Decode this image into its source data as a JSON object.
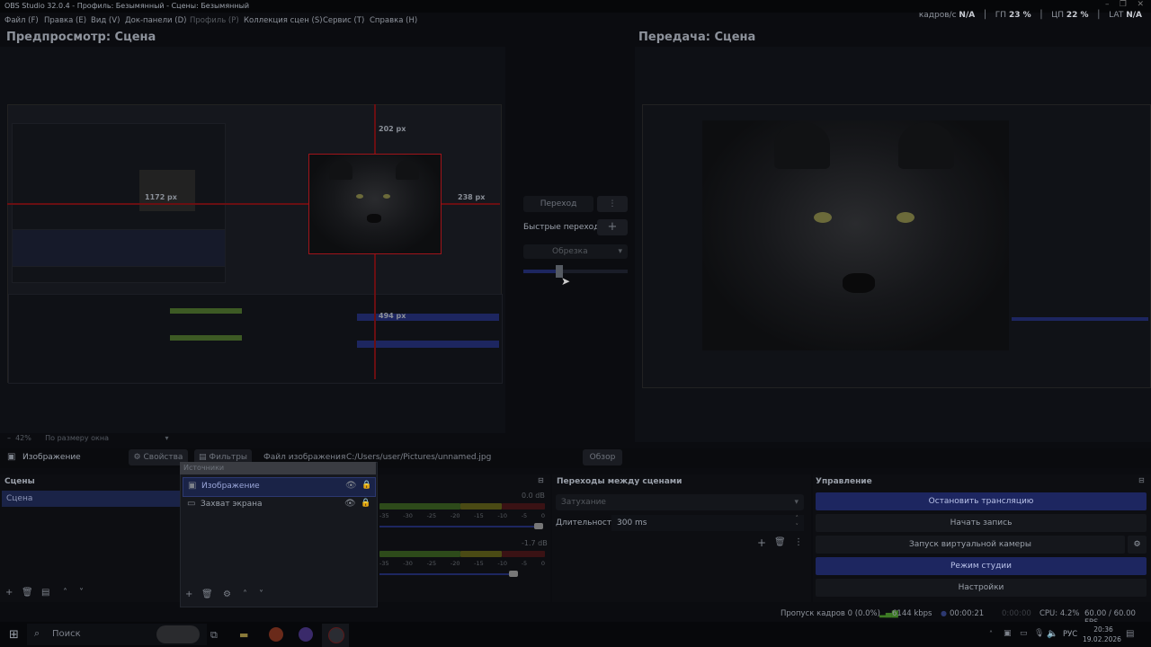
{
  "window": {
    "title": "OBS Studio 32.0.4 - Профиль: Безымянный - Сцены: Безымянный"
  },
  "menu": [
    "Файл (F)",
    "Правка (E)",
    "Вид (V)",
    "Док-панели (D)",
    "Профиль (P)",
    "Коллекция сцен (S)",
    "Сервис (T)",
    "Справка (H)"
  ],
  "stats": {
    "fps_label": "кадров/с",
    "fps": "N/A",
    "gpu_label": "ГП",
    "gpu": "23 %",
    "cpu_label": "ЦП",
    "cpu": "22 %",
    "lat_label": "LAT",
    "lat": "N/A"
  },
  "preview": {
    "title": "Предпросмотр: Сцена",
    "px_top": "202 px",
    "px_left": "1172 px",
    "px_right": "238 px",
    "px_bottom": "494 px",
    "zoom": "42%",
    "zoom_mode": "По размеру окна"
  },
  "program": {
    "title": "Передача: Сцена"
  },
  "transition_center": {
    "transition_button": "Переход",
    "quick_transitions": "Быстрые переходы",
    "dropdown": "Обрезка"
  },
  "source_toolbar": {
    "source_name": "Изображение",
    "properties": "Свойства",
    "filters": "Фильтры",
    "file_label": "Файл изображения",
    "file_path": "C:/Users/user/Pictures/unnamed.jpg",
    "browse": "Обзор"
  },
  "scenes": {
    "header": "Сцены",
    "items": [
      "Сцена"
    ]
  },
  "sources": {
    "header": "Источники",
    "items": [
      {
        "name": "Изображение"
      },
      {
        "name": "Захват экрана"
      }
    ]
  },
  "mixer": {
    "db1": "0.0 dB",
    "db2": "-1.7 dB",
    "ticks": [
      "-35",
      "-30",
      "-25",
      "-20",
      "-15",
      "-10",
      "-5",
      "0"
    ]
  },
  "transitions": {
    "header": "Переходы между сценами",
    "selected": "Затухание",
    "duration_label": "Длительность",
    "duration": "300 ms"
  },
  "controls": {
    "header": "Управление",
    "stop_stream": "Остановить трансляцию",
    "start_record": "Начать запись",
    "virtual_cam": "Запуск виртуальной камеры",
    "studio_mode": "Режим студии",
    "settings": "Настройки"
  },
  "statusbar": {
    "dropped": "Пропуск кадров 0 (0.0%)",
    "bitrate": "6144 kbps",
    "stream_time": "00:00:21",
    "rec_time": "0:00:00",
    "cpu": "CPU: 4.2%",
    "fps": "60.00 / 60.00 FPS"
  },
  "taskbar": {
    "search": "Поиск",
    "lang": "РУС",
    "time": "20:36",
    "date": "19.02.2026"
  },
  "colors": {
    "accent": "#1d2660",
    "selection": "#1a2347",
    "guide_red": "#a0141a"
  }
}
